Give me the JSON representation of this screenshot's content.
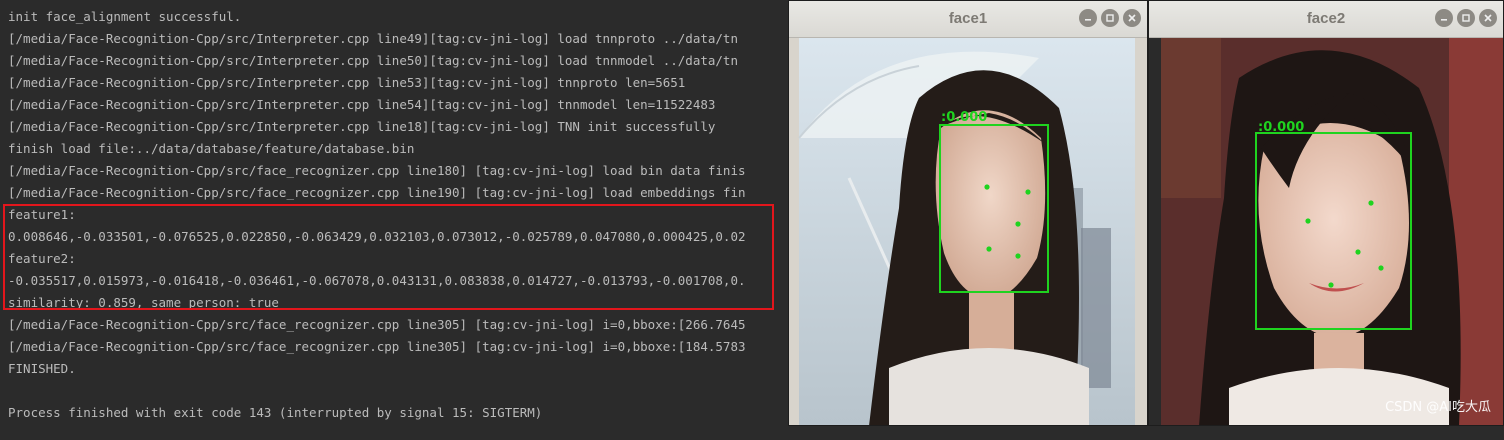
{
  "console": {
    "lines": [
      "init face_alignment successful.",
      "[/media/Face-Recognition-Cpp/src/Interpreter.cpp line49][tag:cv-jni-log] load tnnproto ../data/tn",
      "[/media/Face-Recognition-Cpp/src/Interpreter.cpp line50][tag:cv-jni-log] load tnnmodel ../data/tn",
      "[/media/Face-Recognition-Cpp/src/Interpreter.cpp line53][tag:cv-jni-log] tnnproto len=5651",
      "[/media/Face-Recognition-Cpp/src/Interpreter.cpp line54][tag:cv-jni-log] tnnmodel len=11522483",
      "[/media/Face-Recognition-Cpp/src/Interpreter.cpp line18][tag:cv-jni-log] TNN init successfully",
      "finish load file:../data/database/feature/database.bin",
      "[/media/Face-Recognition-Cpp/src/face_recognizer.cpp line180] [tag:cv-jni-log] load bin data finis",
      "[/media/Face-Recognition-Cpp/src/face_recognizer.cpp line190] [tag:cv-jni-log] load embeddings fin",
      "feature1:",
      "0.008646,-0.033501,-0.076525,0.022850,-0.063429,0.032103,0.073012,-0.025789,0.047080,0.000425,0.02",
      "feature2:",
      "-0.035517,0.015973,-0.016418,-0.036461,-0.067078,0.043131,0.083838,0.014727,-0.013793,-0.001708,0.",
      "similarity: 0.859, same person: true",
      "[/media/Face-Recognition-Cpp/src/face_recognizer.cpp line305] [tag:cv-jni-log] i=0,bboxe:[266.7645",
      "[/media/Face-Recognition-Cpp/src/face_recognizer.cpp line305] [tag:cv-jni-log] i=0,bboxe:[184.5783",
      "FINISHED.",
      "",
      "Process finished with exit code 143 (interrupted by signal 15: SIGTERM)"
    ]
  },
  "windows": [
    {
      "title": "face1",
      "score_label": ":0.000"
    },
    {
      "title": "face2",
      "score_label": ":0.000"
    }
  ],
  "watermark": "CSDN @AI吃大瓜",
  "colors": {
    "console_bg": "#2b2b2b",
    "console_text": "#bbbbbb",
    "highlight": "#e3161c",
    "detect_box": "#1fd31f",
    "titlebar": "#dedcd8"
  },
  "icons": [
    "minimize-icon",
    "maximize-icon",
    "close-icon"
  ]
}
